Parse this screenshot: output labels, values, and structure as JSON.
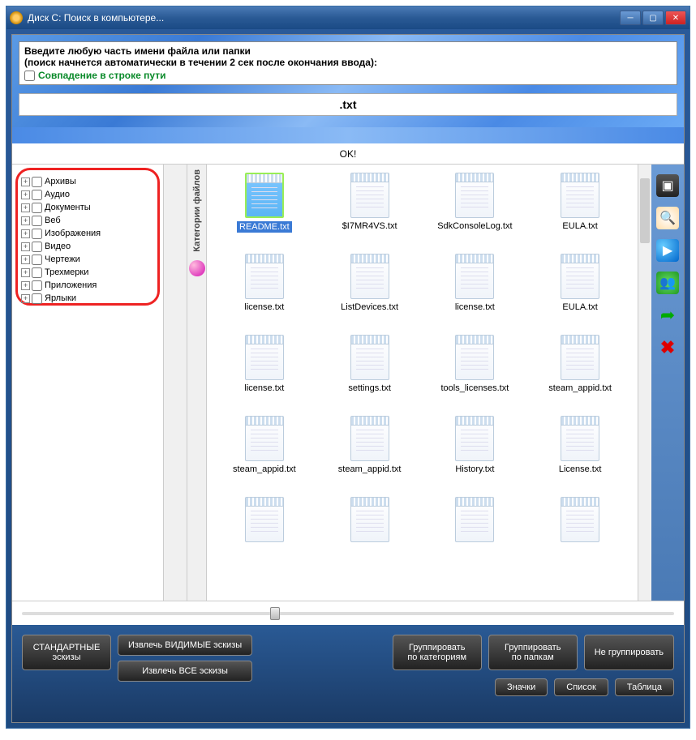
{
  "window_title": "Диск C: Поиск в компьютере...",
  "prompt": {
    "line1": "Введите любую часть имени файла или папки",
    "line2": "(поиск начнется автоматически в течении 2 сек после окончания ввода):",
    "match_label": "Совпадение в строке пути"
  },
  "search_value": ".txt",
  "status": "OK!",
  "categories_label": "Категории файлов",
  "tree": [
    {
      "label": "Архивы"
    },
    {
      "label": "Аудио"
    },
    {
      "label": "Документы"
    },
    {
      "label": "Веб"
    },
    {
      "label": "Изображения"
    },
    {
      "label": "Видео"
    },
    {
      "label": "Чертежи"
    },
    {
      "label": "Трехмерки"
    },
    {
      "label": "Приложения"
    },
    {
      "label": "Ярлыки"
    }
  ],
  "files": [
    {
      "name": "README.txt",
      "selected": true
    },
    {
      "name": "$I7MR4VS.txt"
    },
    {
      "name": "SdkConsoleLog.txt"
    },
    {
      "name": "EULA.txt"
    },
    {
      "name": "license.txt"
    },
    {
      "name": "ListDevices.txt"
    },
    {
      "name": "license.txt"
    },
    {
      "name": "EULA.txt"
    },
    {
      "name": "license.txt"
    },
    {
      "name": "settings.txt"
    },
    {
      "name": "tools_licenses.txt"
    },
    {
      "name": "steam_appid.txt"
    },
    {
      "name": "steam_appid.txt"
    },
    {
      "name": "steam_appid.txt"
    },
    {
      "name": "History.txt"
    },
    {
      "name": "License.txt"
    }
  ],
  "buttons": {
    "std_thumbs_l1": "СТАНДАРТНЫЕ",
    "std_thumbs_l2": "эскизы",
    "extract_visible": "Извлечь ВИДИМЫЕ эскизы",
    "extract_all": "Извлечь ВСЕ эскизы",
    "group_cat_l1": "Группировать",
    "group_cat_l2": "по категориям",
    "group_folder_l1": "Группировать",
    "group_folder_l2": "по папкам",
    "no_group": "Не группировать",
    "icons": "Значки",
    "list": "Список",
    "table": "Таблица"
  }
}
